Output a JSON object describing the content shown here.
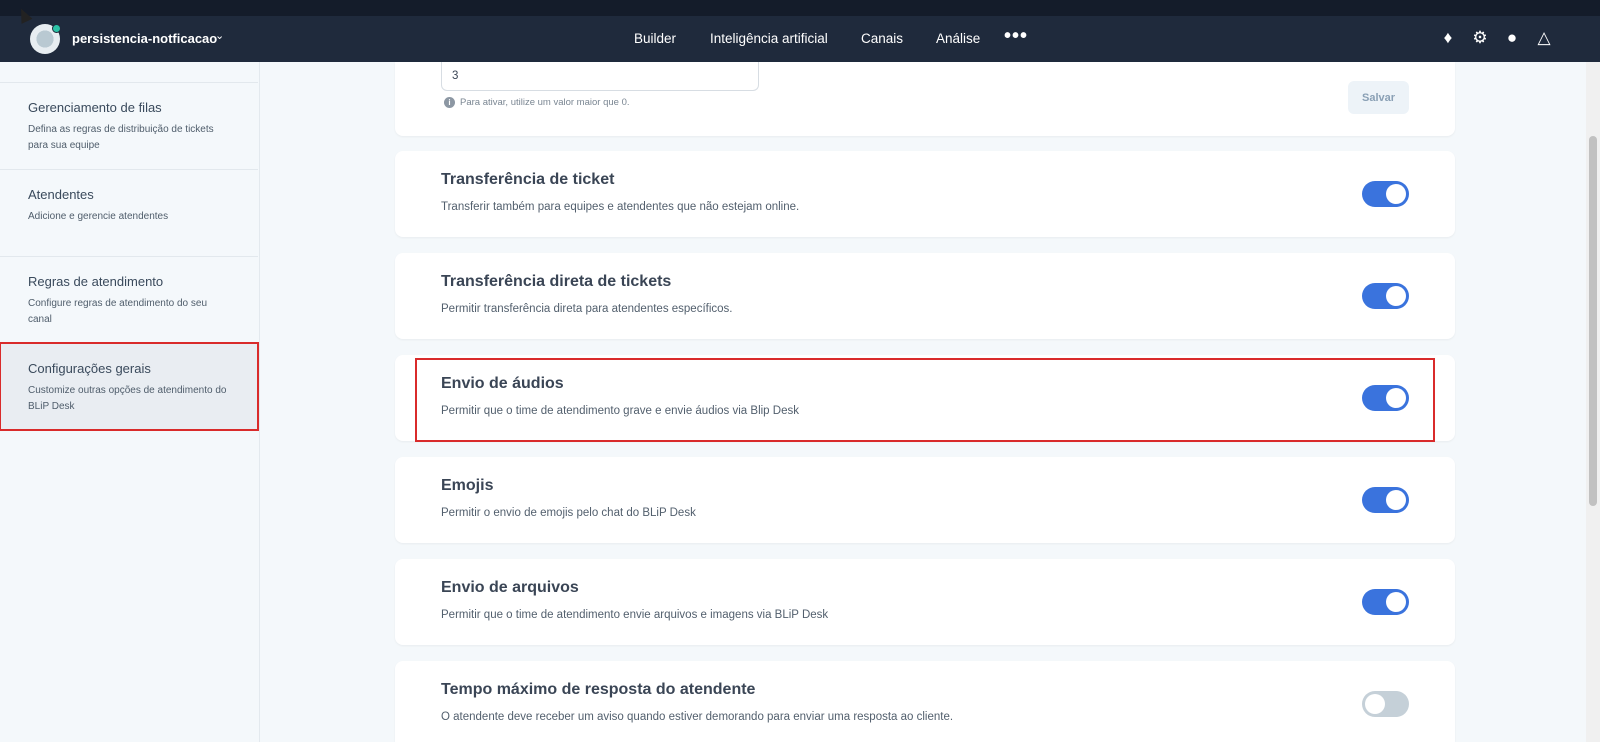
{
  "topbar": {
    "bot_name": "persistencia-notficacao",
    "nav": [
      "Builder",
      "Inteligência artificial",
      "Canais",
      "Análise"
    ],
    "more": "•••",
    "icons": [
      "puzzle-icon",
      "gear-icon",
      "team-icon",
      "flask-icon"
    ]
  },
  "sidebar": {
    "items": [
      {
        "title": "Gerenciamento de filas",
        "desc": "Defina as regras de distribuição de tickets para sua equipe"
      },
      {
        "title": "Atendentes",
        "desc": "Adicione e gerencie atendentes"
      },
      {
        "title": "Regras de atendimento",
        "desc": "Configure regras de atendimento do seu canal"
      },
      {
        "title": "Configurações gerais",
        "desc": "Customize outras opções de atendimento do BLiP Desk"
      }
    ]
  },
  "first_card": {
    "input_value": "3",
    "hint": "Para ativar, utilize um valor maior que 0.",
    "save_label": "Salvar"
  },
  "settings": [
    {
      "title": "Transferência de ticket",
      "desc": "Transferir também para equipes e atendentes que não estejam online.",
      "enabled": true
    },
    {
      "title": "Transferência direta de tickets",
      "desc": "Permitir transferência direta para atendentes específicos.",
      "enabled": true
    },
    {
      "title": "Envio de áudios",
      "desc": "Permitir que o time de atendimento grave e envie áudios via Blip Desk",
      "enabled": true
    },
    {
      "title": "Emojis",
      "desc": "Permitir o envio de emojis pelo chat do BLiP Desk",
      "enabled": true
    },
    {
      "title": "Envio de arquivos",
      "desc": "Permitir que o time de atendimento envie arquivos e imagens via BLiP Desk",
      "enabled": true
    },
    {
      "title": "Tempo máximo de resposta do atendente",
      "desc": "O atendente deve receber um aviso quando estiver demorando para enviar uma resposta ao cliente.",
      "enabled": false
    }
  ],
  "colors": {
    "accent": "#3a73dd",
    "topbar": "#1f2a3c",
    "highlight": "#d92b2b"
  }
}
